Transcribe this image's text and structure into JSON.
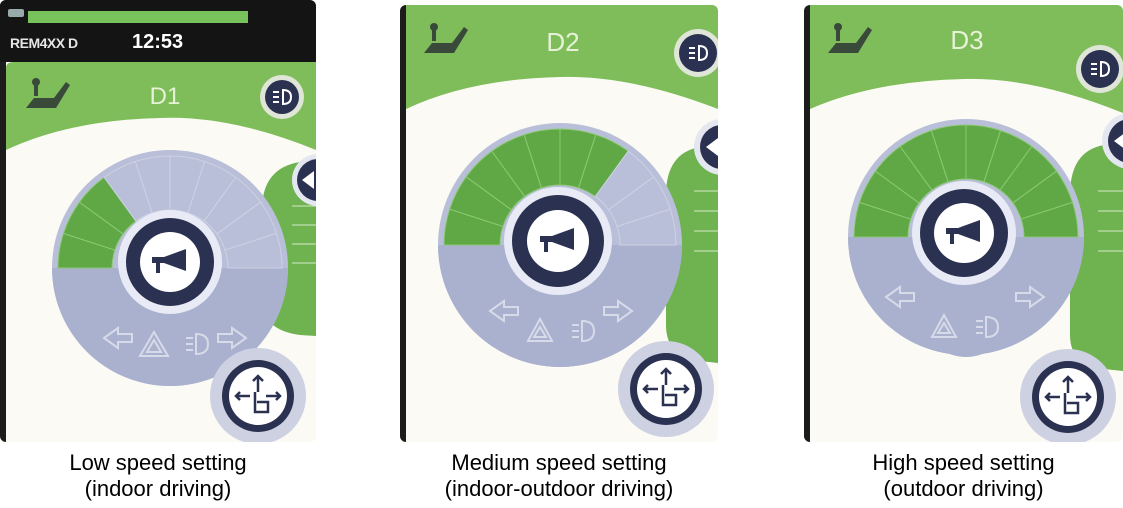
{
  "panels": [
    {
      "top_bar": {
        "name": "REM4XX D",
        "time": "12:53"
      },
      "drive_label": "D1",
      "speed_level": 3,
      "caption_line1": "Low speed setting",
      "caption_line2": "(indoor driving)"
    },
    {
      "drive_label": "D2",
      "speed_level": 7,
      "caption_line1": "Medium speed setting",
      "caption_line2": "(indoor-outdoor driving)"
    },
    {
      "drive_label": "D3",
      "speed_level": 10,
      "caption_line1": "High speed setting",
      "caption_line2": "(outdoor driving)"
    }
  ],
  "speed_segments_total": 10,
  "colors": {
    "header_green": "#7fbd5a",
    "gauge_green": "#5fa845",
    "gauge_empty": "#b9bfd8",
    "dial_dark": "#2b3150",
    "screen_bg": "#fbfaf5"
  },
  "icons": {
    "seat": "seat-icon",
    "lights": "headlight-icon",
    "horn": "horn-icon",
    "joystick": "joystick-touch-icon",
    "left": "left-indicator-icon",
    "right": "right-indicator-icon",
    "hazard": "hazard-icon"
  }
}
